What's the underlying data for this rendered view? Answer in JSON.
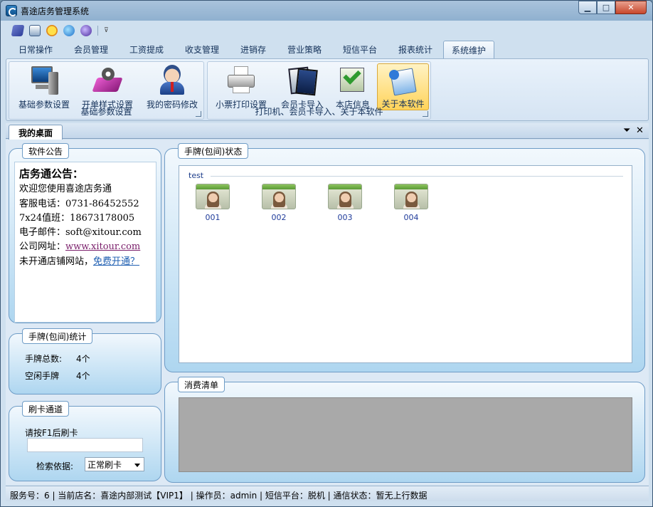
{
  "window": {
    "title": "喜途店务管理系统",
    "controls": {
      "minimize": "▁",
      "maximize": "□",
      "close": "✕"
    }
  },
  "quick_access": {
    "icons": [
      "book-icon",
      "printer-icon",
      "smiley-icon",
      "ie-browser-icon",
      "globe-icon"
    ],
    "more": "⊽"
  },
  "tabs": [
    {
      "label": "日常操作"
    },
    {
      "label": "会员管理"
    },
    {
      "label": "工资提成"
    },
    {
      "label": "收支管理"
    },
    {
      "label": "进销存"
    },
    {
      "label": "营业策略"
    },
    {
      "label": "短信平台"
    },
    {
      "label": "报表统计"
    },
    {
      "label": "系统维护",
      "active": true
    }
  ],
  "ribbon": {
    "groups": [
      {
        "title": "基础参数设置",
        "buttons": [
          {
            "label": "基础参数设置",
            "icon": "computer-icon"
          },
          {
            "label": "开单样式设置",
            "icon": "template-settings-icon"
          },
          {
            "label": "我的密码修改",
            "icon": "user-avatar-icon"
          }
        ]
      },
      {
        "title": "打印机、会员卡导入、关于本软件",
        "buttons": [
          {
            "label": "小票打印设置",
            "icon": "printer-icon"
          },
          {
            "label": "会员卡导入",
            "icon": "card-import-icon"
          },
          {
            "label": "本店信息",
            "icon": "store-info-icon"
          },
          {
            "label": "关于本软件",
            "icon": "about-icon",
            "active": true
          }
        ]
      }
    ]
  },
  "doc_tab": {
    "label": "我的桌面",
    "pin": "⏷",
    "close": "✕"
  },
  "notice_panel": {
    "title": "软件公告",
    "heading": "店务通公告：",
    "lines": [
      "欢迎您使用喜途店务通",
      "客服电话：0731-86452552",
      "7x24值班：18673178005",
      "电子邮件：soft@xitour.com"
    ],
    "website_label": "公司网址：",
    "website": "www.xitour.com",
    "shop_label": "未开通店铺网站，",
    "shop_link": "免费开通？"
  },
  "stats_panel": {
    "title": "手牌(包间)统计",
    "total_label": "手牌总数:",
    "total_value": "4个",
    "idle_label": "空闲手牌",
    "idle_value": "4个"
  },
  "card_panel": {
    "title": "刷卡通道",
    "prompt": "请按F1后刷卡",
    "input_value": "",
    "search_label": "检索依据:",
    "search_selected": "正常刷卡"
  },
  "tables_panel": {
    "title": "手牌(包间)状态",
    "group": "test",
    "items": [
      "001",
      "002",
      "003",
      "004"
    ]
  },
  "consume_panel": {
    "title": "消费清单"
  },
  "status_bar": {
    "text": "服务号：6  |  当前店名：喜途内部测试【VIP1】  |  操作员：admin  |  短信平台：脱机  |  通信状态：暂无上行数据"
  },
  "colors": {
    "accent": "#6e9cc6",
    "active_button": "#ffd35a",
    "panel_bg": "#aed6f0"
  }
}
